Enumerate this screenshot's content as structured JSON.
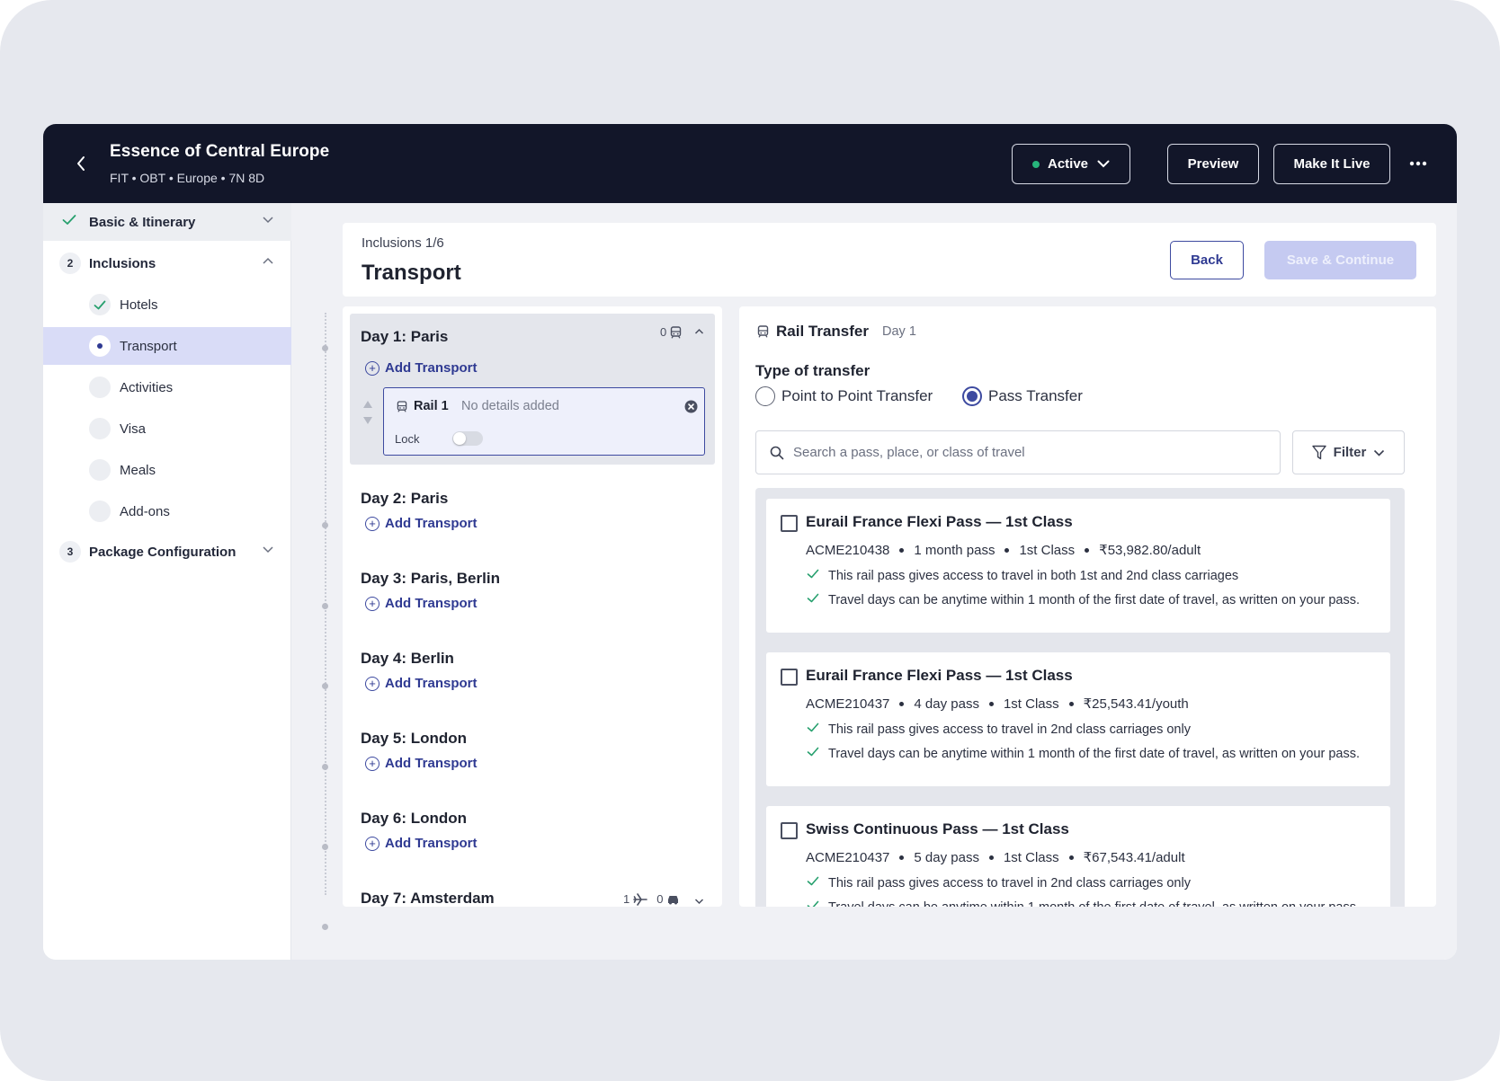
{
  "header": {
    "title": "Essence of Central Europe",
    "subtitle": "FIT • OBT • Europe • 7N 8D",
    "status_label": "Active",
    "status_color": "#27b57c",
    "preview_label": "Preview",
    "make_live_label": "Make It Live"
  },
  "sidebar": {
    "sections": [
      {
        "number": "",
        "label": "Basic & Itinerary",
        "state": "done"
      },
      {
        "number": "2",
        "label": "Inclusions",
        "state": "expanded"
      },
      {
        "number": "3",
        "label": "Package Configuration",
        "state": "collapsed"
      }
    ],
    "inclusions": [
      {
        "label": "Hotels",
        "state": "done"
      },
      {
        "label": "Transport",
        "state": "active"
      },
      {
        "label": "Activities",
        "state": "pending"
      },
      {
        "label": "Visa",
        "state": "pending"
      },
      {
        "label": "Meals",
        "state": "pending"
      },
      {
        "label": "Add-ons",
        "state": "pending"
      }
    ]
  },
  "page": {
    "breadcrumb": "Inclusions 1/6",
    "title": "Transport",
    "back_label": "Back",
    "save_label": "Save & Continue"
  },
  "days": {
    "add_label": "Add Transport",
    "items": [
      {
        "title": "Day 1: Paris",
        "rail_count": "0"
      },
      {
        "title": "Day 2: Paris"
      },
      {
        "title": "Day 3: Paris, Berlin"
      },
      {
        "title": "Day 4: Berlin"
      },
      {
        "title": "Day 5: London"
      },
      {
        "title": "Day 6: London"
      },
      {
        "title": "Day 7: Amsterdam",
        "flight_count": "1",
        "car_count": "0"
      }
    ],
    "rail_card": {
      "name": "Rail 1",
      "detail": "No details added",
      "lock_label": "Lock",
      "locked": false
    }
  },
  "rail_panel": {
    "title": "Rail Transfer",
    "day": "Day 1",
    "type_label": "Type of transfer",
    "options": [
      "Point to Point Transfer",
      "Pass Transfer"
    ],
    "selected_option": "Pass Transfer",
    "search_placeholder": "Search a pass, place, or class of travel",
    "filter_label": "Filter",
    "passes": [
      {
        "name": "Eurail France Flexi Pass — 1st Class",
        "code": "ACME210438",
        "duration": "1 month pass",
        "class": "1st Class",
        "price": "₹53,982.80/adult",
        "features": [
          "This rail pass gives access to travel in both 1st and 2nd class carriages",
          "Travel days can be anytime within 1 month of the first date of travel, as written on your pass."
        ]
      },
      {
        "name": "Eurail France Flexi Pass — 1st Class",
        "code": "ACME210437",
        "duration": "4 day pass",
        "class": "1st Class",
        "price": "₹25,543.41/youth",
        "features": [
          "This rail pass gives access to travel in 2nd class carriages only",
          "Travel days can be anytime within 1 month of the first date of travel, as written on your pass."
        ]
      },
      {
        "name": "Swiss Continuous Pass — 1st Class",
        "code": "ACME210437",
        "duration": "5 day pass",
        "class": "1st Class",
        "price": "₹67,543.41/adult",
        "features": [
          "This rail pass gives access to travel in 2nd class carriages only",
          "Travel days can be anytime within 1 month of the first date of travel, as written on your pass."
        ]
      }
    ]
  },
  "colors": {
    "navy": "#121629",
    "accent": "#3d4aa0",
    "active_row": "#d9dcf7",
    "check_green": "#27a06e"
  }
}
